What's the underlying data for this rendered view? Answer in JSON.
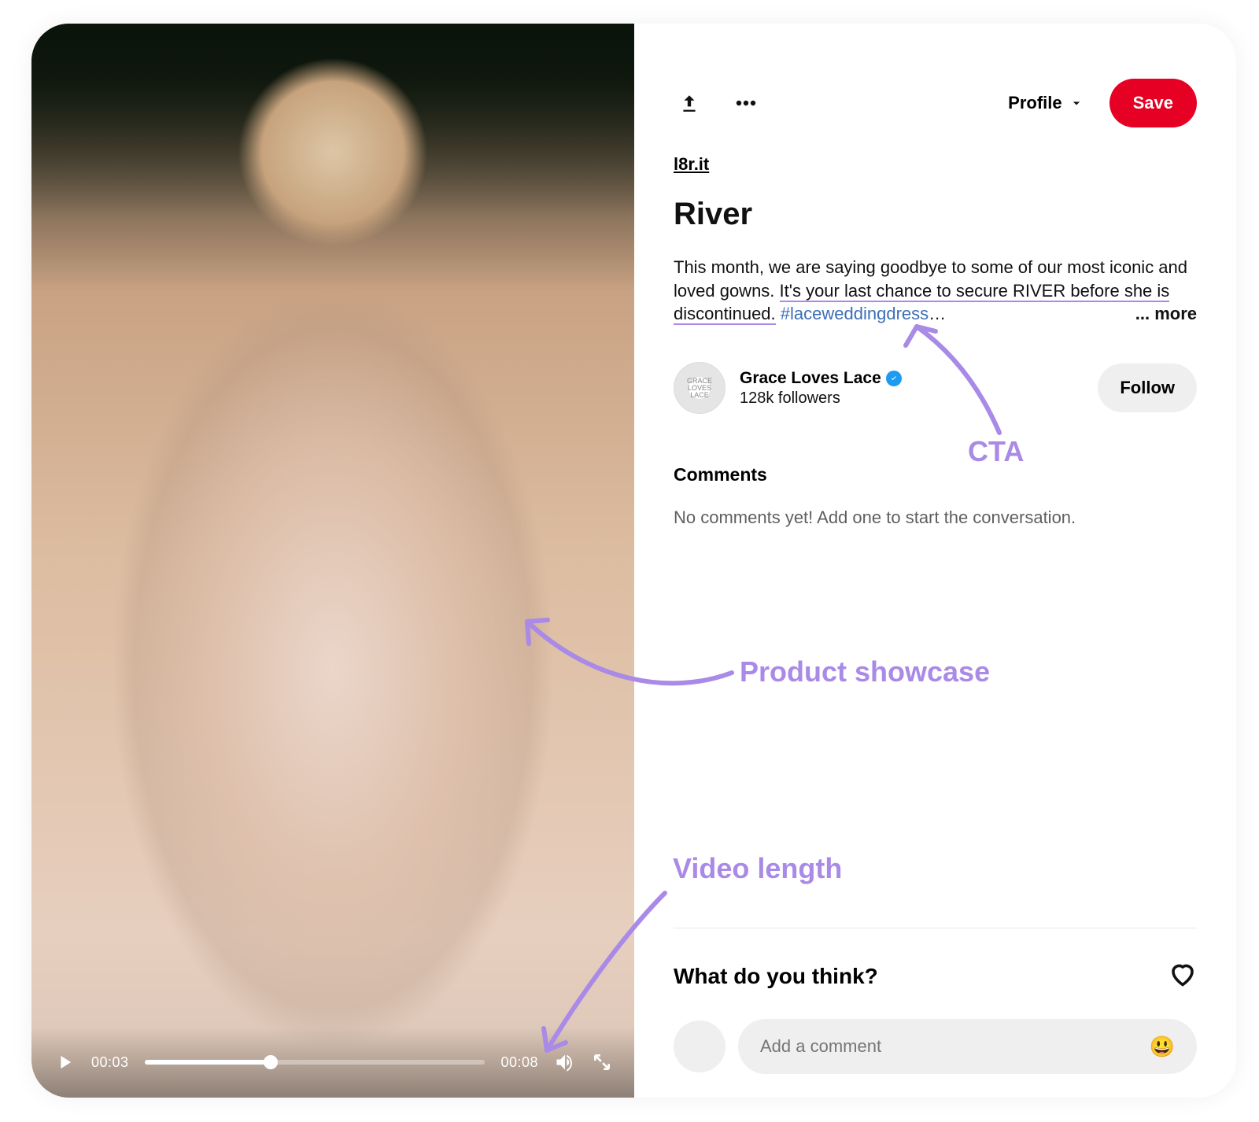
{
  "topbar": {
    "profile_label": "Profile",
    "save_label": "Save"
  },
  "source_link": "l8r.it",
  "pin": {
    "title": "River",
    "desc_plain_prefix": "This month, we are saying goodbye to some of our most iconic and loved gowns. ",
    "desc_cta": "It's your last chance to secure RIVER before she is discontinued.",
    "desc_hashtag": "#laceweddingdress",
    "desc_ellipsis": "…",
    "more_label": "... more"
  },
  "author": {
    "name": "Grace Loves Lace",
    "followers": "128k followers",
    "follow_label": "Follow"
  },
  "comments": {
    "heading": "Comments",
    "empty": "No comments yet! Add one to start the conversation."
  },
  "bottom": {
    "prompt": "What do you think?",
    "comment_placeholder": "Add a comment"
  },
  "video": {
    "current_time": "00:03",
    "total_time": "00:08"
  },
  "annotations": {
    "cta": "CTA",
    "product": "Product showcase",
    "length": "Video length"
  }
}
